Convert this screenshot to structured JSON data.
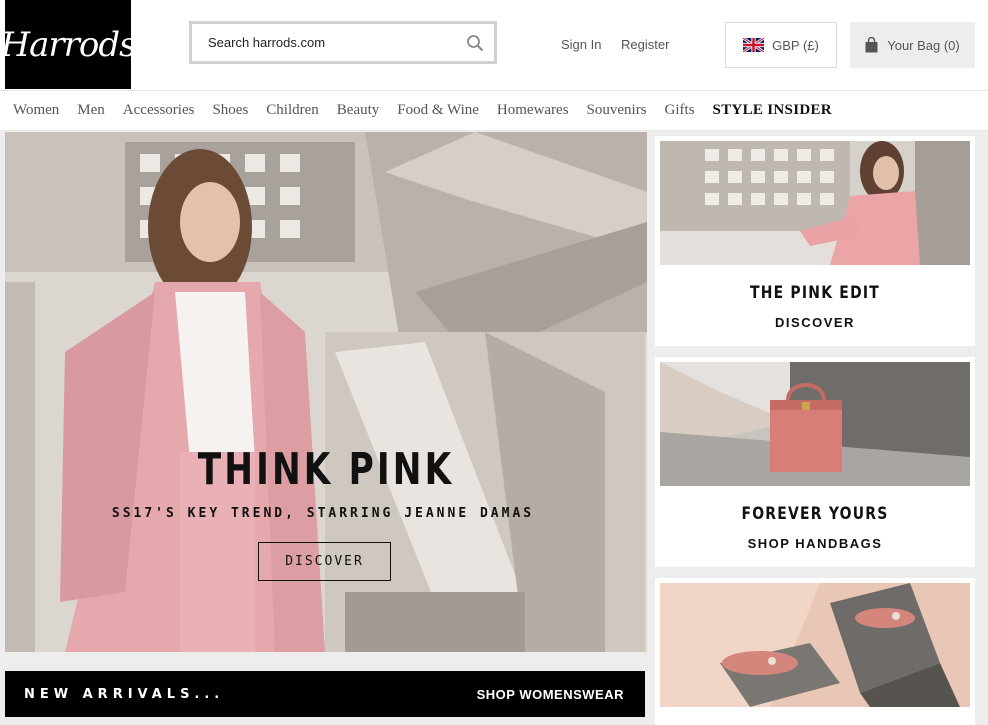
{
  "brand": {
    "logo_text": "Harrods"
  },
  "header": {
    "search_placeholder": "Search harrods.com",
    "sign_in": "Sign In",
    "register": "Register",
    "currency": "GBP (£)",
    "bag": "Your Bag (0)"
  },
  "nav": {
    "items": [
      "Women",
      "Men",
      "Accessories",
      "Shoes",
      "Children",
      "Beauty",
      "Food & Wine",
      "Homewares",
      "Souvenirs",
      "Gifts",
      "STYLE INSIDER"
    ]
  },
  "hero": {
    "title": "THINK PINK",
    "subtitle": "SS17'S KEY TREND, STARRING JEANNE DAMAS",
    "button": "DISCOVER"
  },
  "arrivals": {
    "label": "NEW ARRIVALS...",
    "link": "SHOP WOMENSWEAR"
  },
  "cards": [
    {
      "title": "THE PINK EDIT",
      "link": "DISCOVER"
    },
    {
      "title": "FOREVER YOURS",
      "link": "SHOP HANDBAGS"
    },
    {
      "title": "",
      "link": ""
    }
  ],
  "colors": {
    "brand_black": "#000000",
    "accent_pink": "#e7a9aa",
    "background": "#ededed"
  },
  "icons": [
    "search-icon",
    "uk-flag-icon",
    "bag-icon"
  ]
}
